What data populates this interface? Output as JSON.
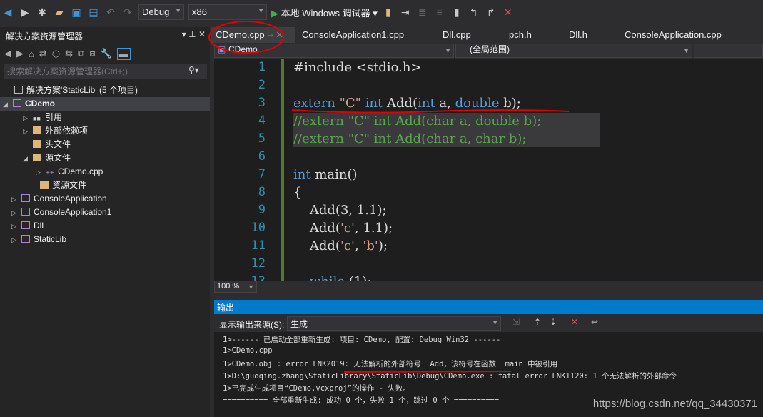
{
  "toolbar": {
    "config": "Debug",
    "platform": "x86",
    "run_label": "本地 Windows 调试器"
  },
  "solution_explorer": {
    "title": "解决方案资源管理器",
    "search_placeholder": "搜索解决方案资源管理器(Ctrl+;)",
    "items": [
      {
        "label": "解决方案'StaticLib' (5 个项目)"
      },
      {
        "label": "CDemo"
      },
      {
        "label": "引用"
      },
      {
        "label": "外部依赖项"
      },
      {
        "label": "头文件"
      },
      {
        "label": "源文件"
      },
      {
        "label": "CDemo.cpp"
      },
      {
        "label": "资源文件"
      },
      {
        "label": "ConsoleApplication"
      },
      {
        "label": "ConsoleApplication1"
      },
      {
        "label": "Dll"
      },
      {
        "label": "StaticLib"
      }
    ]
  },
  "tabs": [
    {
      "label": "CDemo.cpp"
    },
    {
      "label": "ConsoleApplication1.cpp"
    },
    {
      "label": "Dll.cpp"
    },
    {
      "label": "pch.h"
    },
    {
      "label": "Dll.h"
    },
    {
      "label": "ConsoleApplication.cpp"
    }
  ],
  "navbar": {
    "project": "CDemo",
    "scope": "(全局范围)"
  },
  "editor": {
    "line_numbers": [
      "1",
      "2",
      "3",
      "4",
      "5",
      "6",
      "7",
      "8",
      "9",
      "10",
      "11",
      "12",
      "13"
    ],
    "lines": [
      "#include <stdio.h>",
      "",
      "extern \"C\" int Add(int a, double b);",
      "//extern \"C\" int Add(char a, double b);",
      "//extern \"C\" int Add(char a, char b);",
      "",
      "int main()",
      "{",
      "    Add(3, 1.1);",
      "    Add('c', 1.1);",
      "    Add('c', 'b');",
      "",
      "    while (1);"
    ],
    "zoom": "100 %"
  },
  "output": {
    "title": "输出",
    "source_label": "显示输出来源(S):",
    "source_value": "生成",
    "lines": [
      "1>------ 已启动全部重新生成: 项目: CDemo, 配置: Debug Win32 ------",
      "1>CDemo.cpp",
      "1>CDemo.obj : error LNK2019: 无法解析的外部符号 _Add，该符号在函数 _main 中被引用",
      "1>D:\\guoqing.zhang\\StaticLibrary\\StaticLib\\Debug\\CDemo.exe : fatal error LNK1120: 1 个无法解析的外部命令",
      "1>已完成生成项目“CDemo.vcxproj”的操作 - 失败。",
      "========== 全部重新生成: 成功 0 个，失败 1 个，跳过 0 个 =========="
    ]
  },
  "watermark": "https://blog.csdn.net/qq_34430371",
  "colors": {
    "accent": "#007acc",
    "annotation": "#e00000"
  }
}
